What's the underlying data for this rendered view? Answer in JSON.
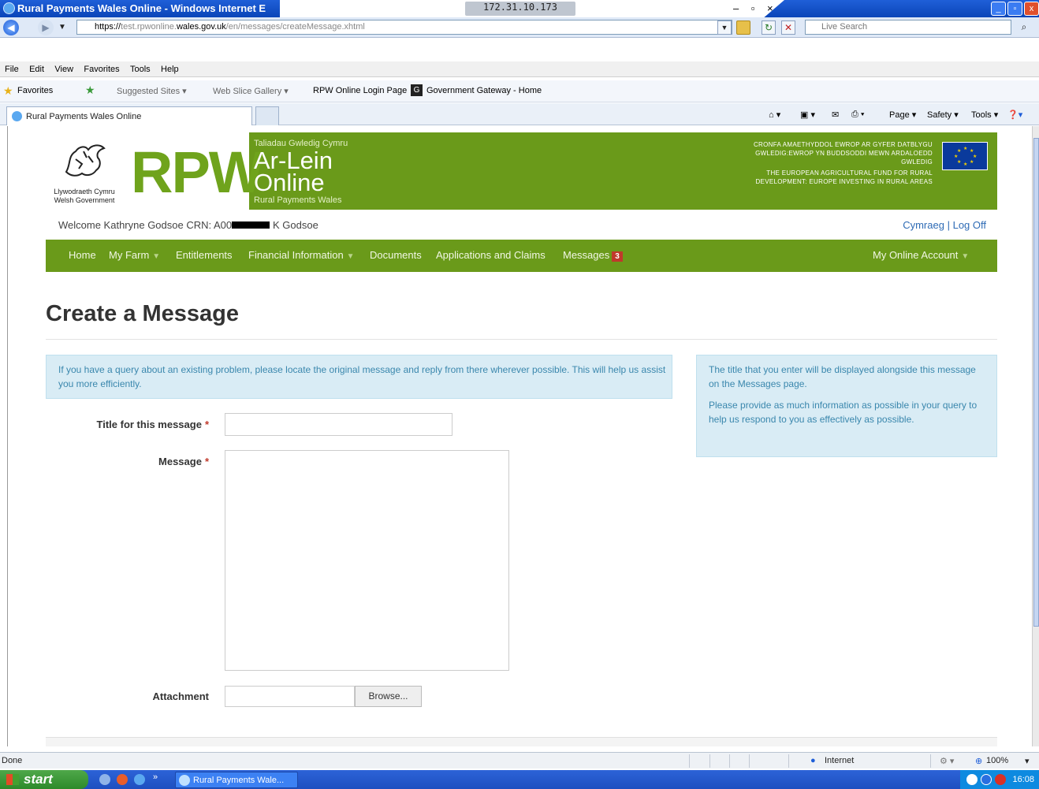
{
  "window": {
    "title": "Rural Payments Wales Online - Windows Internet E",
    "remote_ip": "172.31.10.173",
    "minimize": "_",
    "restore": "▫",
    "close": "x"
  },
  "browser": {
    "url_prefix": "https://",
    "url_pre_domain": "test.rpwonline.",
    "url_domain": "wales.gov.uk",
    "url_path": "/en/messages/createMessage.xhtml",
    "search_placeholder": "Live Search",
    "menu": [
      "File",
      "Edit",
      "View",
      "Favorites",
      "Tools",
      "Help"
    ],
    "favorites_label": "Favorites",
    "favorites_links": [
      "Suggested Sites ▾",
      "Web Slice Gallery ▾",
      "RPW Online Login Page",
      "Government Gateway - Home"
    ],
    "tab_title": "Rural Payments Wales Online",
    "commands": [
      "Page ▾",
      "Safety ▾",
      "Tools ▾"
    ]
  },
  "page": {
    "gov_logo_text_line1": "Llywodraeth Cymru",
    "gov_logo_text_line2": "Welsh Government",
    "brand_abbrev": "RPW",
    "brand_top": "Taliadau Gwledig Cymru",
    "brand_line1": "Ar-Lein",
    "brand_line2": "Online",
    "brand_sub": "Rural Payments Wales",
    "eu_text_1": "CRONFA AMAETHYDDOL EWROP AR GYFER DATBLYGU GWLEDIG:EWROP YN BUDDSODDI MEWN ARDALOEDD GWLEDIG",
    "eu_text_2": "THE EUROPEAN AGRICULTURAL FUND FOR RURAL DEVELOPMENT: EUROPE INVESTING IN RURAL AREAS",
    "welcome_prefix": "Welcome Kathryne Godsoe CRN: A00",
    "welcome_suffix": "K Godsoe",
    "lang_link": "Cymraeg",
    "lang_sep": "|",
    "logoff_link": "Log Off",
    "nav": {
      "home": "Home",
      "my_farm": "My Farm",
      "entitlements": "Entitlements",
      "financial": "Financial Information",
      "documents": "Documents",
      "applications": "Applications and Claims",
      "messages": "Messages",
      "messages_count": "3",
      "account": "My Online Account"
    },
    "title": "Create a Message",
    "info_left": "If you have a query about an existing problem, please locate the original message and reply from there wherever possible. This will help us assist you more efficiently.",
    "info_right_1": "The title that you enter will be displayed alongside this message on the Messages page.",
    "info_right_2": "Please provide as much information as possible in your query to help us respond to you as effectively as possible.",
    "form": {
      "title_label": "Title for this message",
      "title_value": "",
      "message_label": "Message",
      "message_value": "",
      "required_marker": "*",
      "attachment_label": "Attachment",
      "browse_label": "Browse..."
    }
  },
  "status": {
    "text": "Done",
    "zone": "Internet",
    "zoom": "100%"
  },
  "taskbar": {
    "start": "start",
    "task": "Rural Payments Wale...",
    "clock": "16:08"
  },
  "colors": {
    "brand_green": "#6a9a1a",
    "info_bg": "#d9ecf5",
    "info_text": "#3a87ad",
    "required": "#c0392b"
  }
}
